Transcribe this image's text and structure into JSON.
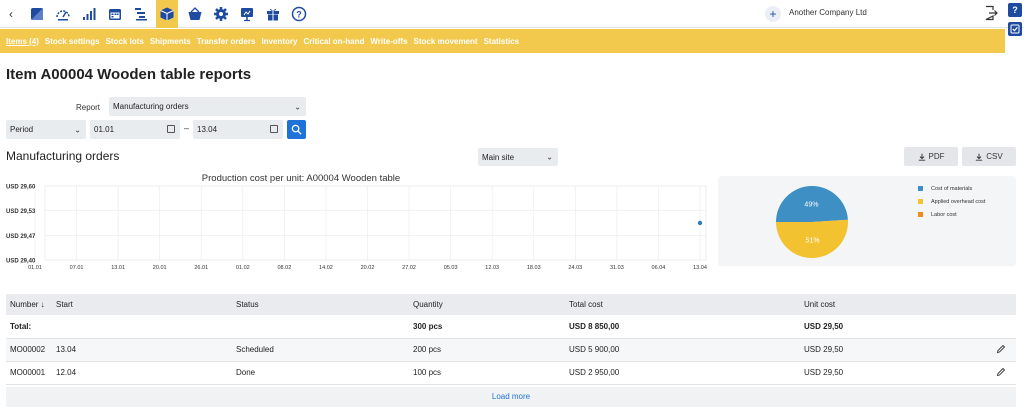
{
  "toolbar": {
    "back": "‹",
    "icons": [
      "dashboard-icon",
      "gauge-icon",
      "bar-signal-icon",
      "calendar-icon",
      "tasks-icon",
      "box-icon",
      "basket-icon",
      "gear-icon",
      "presentation-icon",
      "gift-icon",
      "help-circle-icon"
    ],
    "active_icon": "box-icon",
    "company_plus": "+",
    "company_name": "Another Company Ltd",
    "help_label": "?"
  },
  "nav": {
    "items": [
      "Items (4)",
      "Stock settings",
      "Stock lots",
      "Shipments",
      "Transfer orders",
      "Inventory",
      "Critical on-hand",
      "Write-offs",
      "Stock movement",
      "Statistics"
    ]
  },
  "page": {
    "title": "Item A00004 Wooden table reports",
    "report_label": "Report",
    "report_value": "Manufacturing orders",
    "period_value": "Period",
    "date_from": "01.01",
    "date_to": "13.04",
    "dash": "–",
    "section_title": "Manufacturing orders",
    "site_value": "Main site",
    "pdf_label": "PDF",
    "csv_label": "CSV"
  },
  "chart_data": [
    {
      "type": "line",
      "title": "Production cost per unit: A00004 Wooden table",
      "x": [
        "01.01",
        "07.01",
        "13.01",
        "20.01",
        "26.01",
        "01.02",
        "08.02",
        "14.02",
        "20.02",
        "27.02",
        "05.03",
        "12.03",
        "18.03",
        "24.03",
        "31.03",
        "06.04",
        "13.04"
      ],
      "yticks": [
        "USD 29,60",
        "USD 29,53",
        "USD 29,47",
        "USD 29,40"
      ],
      "ylim": [
        29.4,
        29.6
      ],
      "series": [
        {
          "points": [
            {
              "x": "13.04",
              "y": 29.5
            }
          ]
        }
      ],
      "grid": true
    },
    {
      "type": "pie",
      "labels": [
        "Cost of materials",
        "Applied overhead cost",
        "Labor cost"
      ],
      "values": [
        49,
        51,
        0
      ],
      "value_labels": [
        "49%",
        "51%"
      ],
      "colors": [
        "#3d8fc4",
        "#f2c230",
        "#f08c1e"
      ],
      "legend": "top-right"
    }
  ],
  "table": {
    "headers": [
      "Number ↓",
      "Start",
      "Status",
      "Quantity",
      "Total cost",
      "Unit cost"
    ],
    "total": {
      "label": "Total:",
      "quantity": "300 pcs",
      "total_cost": "USD 8 850,00",
      "unit_cost": "USD 29,50"
    },
    "rows": [
      {
        "number": "MO00002",
        "start": "13.04",
        "status": "Scheduled",
        "quantity": "200 pcs",
        "total_cost": "USD 5 900,00",
        "unit_cost": "USD 29,50"
      },
      {
        "number": "MO00001",
        "start": "12.04",
        "status": "Done",
        "quantity": "100 pcs",
        "total_cost": "USD 2 950,00",
        "unit_cost": "USD 29,50"
      }
    ],
    "load_more": "Load more"
  }
}
